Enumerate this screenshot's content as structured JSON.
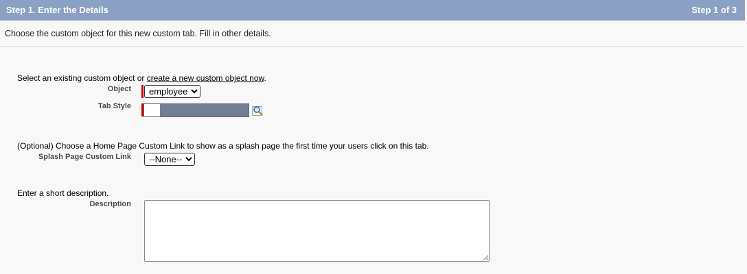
{
  "header": {
    "title": "Step 1. Enter the Details",
    "step": "Step 1 of 3"
  },
  "instructions": "Choose the custom object for this new custom tab. Fill in other details.",
  "object_section": {
    "intro_prefix": "Select an existing custom object or ",
    "intro_link": "create a new custom object now",
    "intro_suffix": ".",
    "object_label": "Object",
    "object_value": "employee",
    "tab_style_label": "Tab Style"
  },
  "splash_section": {
    "intro": "(Optional) Choose a Home Page Custom Link to show as a splash page the first time your users click on this tab.",
    "label": "Splash Page Custom Link",
    "value": "--None--"
  },
  "description_section": {
    "intro": "Enter a short description.",
    "label": "Description",
    "value": ""
  },
  "colors": {
    "header_bg": "#8aa1c4",
    "required_bar": "#cc0000",
    "tab_style_color": "#737f96"
  }
}
